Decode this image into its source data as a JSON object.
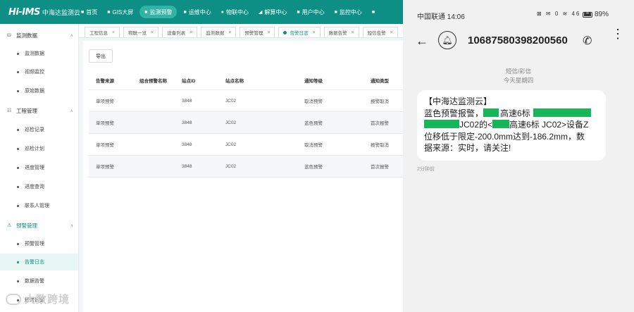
{
  "web": {
    "logo_mark": "Hi-IMS",
    "logo_name": "中海达监测云",
    "nav": [
      {
        "icon": "home-icon",
        "glyph": "■",
        "label": "首页"
      },
      {
        "icon": "map-icon",
        "glyph": "■",
        "label": "GIS大屏"
      },
      {
        "icon": "monitor-icon",
        "glyph": "■",
        "label": "监测预警"
      },
      {
        "icon": "project-icon",
        "glyph": "■",
        "label": "运维中心"
      },
      {
        "icon": "iot-icon",
        "glyph": "●",
        "label": "物联中心"
      },
      {
        "icon": "analysis-icon",
        "glyph": "◢",
        "label": "解算中心"
      },
      {
        "icon": "user-icon",
        "glyph": "■",
        "label": "用户中心"
      },
      {
        "icon": "control-icon",
        "glyph": "■",
        "label": "监控中心"
      },
      {
        "icon": "more-icon",
        "glyph": "■",
        "label": ""
      }
    ],
    "tabs": [
      {
        "label": "工程信息"
      },
      {
        "label": "物联一览"
      },
      {
        "label": "设备列表"
      },
      {
        "label": "监测数据"
      },
      {
        "label": "预警管理"
      },
      {
        "label": "告警日志"
      },
      {
        "label": "数据告警"
      },
      {
        "label": "短信告警"
      }
    ],
    "sidebar": {
      "groups": [
        {
          "icon": "data-icon",
          "glyph": "⛁",
          "label": "监测数据"
        },
        {
          "icon": "engineering-icon",
          "glyph": "☷",
          "label": "工程管理"
        },
        {
          "icon": "alarm-icon",
          "glyph": "⚠",
          "label": "预警管理"
        }
      ],
      "items": [
        {
          "label": "监测数据"
        },
        {
          "label": "视频监控"
        },
        {
          "label": "原始数据"
        },
        {
          "label": "巡检记录"
        },
        {
          "label": "巡检计划"
        },
        {
          "label": "进度管理"
        },
        {
          "label": "进度查询"
        },
        {
          "label": "联系人管理"
        },
        {
          "label": "预警管理"
        },
        {
          "label": "告警日志"
        },
        {
          "label": "数据告警"
        },
        {
          "label": "短信告警"
        }
      ]
    },
    "export_label": "导出",
    "table": {
      "headers": [
        "告警来源",
        "组合预警名称",
        "站点ID",
        "站点名称",
        "通知等级",
        "通知类型"
      ],
      "rows": [
        [
          "单项预警",
          "",
          "3848",
          "JC02",
          "取消预警",
          "报警取消"
        ],
        [
          "单项预警",
          "",
          "3848",
          "JC02",
          "蓝色预警",
          "首次报警"
        ],
        [
          "单项预警",
          "",
          "3848",
          "JC02",
          "取消预警",
          "报警取消"
        ],
        [
          "单项预警",
          "",
          "3848",
          "JC02",
          "蓝色预警",
          "首次报警"
        ]
      ]
    },
    "watermark": "大数跨境"
  },
  "phone": {
    "carrier_time": "中国联通 14:06",
    "status_icons": "⊠ ✉ 0 ≋ 46 ▮▮",
    "battery": "89%",
    "sender": "10687580398200560",
    "msg_type": "短信/彩信",
    "msg_day": "今天星期四",
    "message": {
      "l1": "【中海达监测云】",
      "l2a": "蓝色预警报警，",
      "l2b": "高速6标",
      "l3a": "JC02的<",
      "l3b": "高速6标 JC02>设备Z",
      "l4": "位移低于限定-200.0mm达到-186.2mm，数",
      "l5": "据来源：实时，请关注!"
    },
    "msg_time": "2分钟前"
  }
}
